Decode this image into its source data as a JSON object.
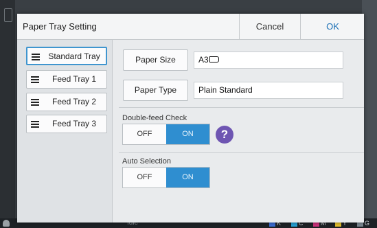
{
  "dialog": {
    "title": "Paper Tray Setting",
    "cancel_label": "Cancel",
    "ok_label": "OK"
  },
  "trays": [
    {
      "label": "Standard Tray",
      "selected": true
    },
    {
      "label": "Feed Tray 1",
      "selected": false
    },
    {
      "label": "Feed Tray 2",
      "selected": false
    },
    {
      "label": "Feed Tray 3",
      "selected": false
    }
  ],
  "paper_size": {
    "label": "Paper Size",
    "value": "A3"
  },
  "paper_type": {
    "label": "Paper Type",
    "value": "Plain Standard"
  },
  "double_feed": {
    "label": "Double-feed Check",
    "off": "OFF",
    "on": "ON",
    "state": "ON"
  },
  "help": {
    "glyph": "?"
  },
  "auto_selection": {
    "label": "Auto Selection",
    "off": "OFF",
    "on": "ON",
    "state": "ON"
  },
  "status_bar": {
    "status_text": "Idle",
    "inks": [
      "K",
      "C",
      "M",
      "Y",
      "G"
    ]
  },
  "colors": {
    "accent": "#2f8ed0",
    "help": "#6e55b2",
    "ink_k": "#3d6fd6",
    "ink_c": "#27a4d8",
    "ink_m": "#d0337e",
    "ink_y": "#e6c22e",
    "ink_g": "#7d8a93"
  }
}
